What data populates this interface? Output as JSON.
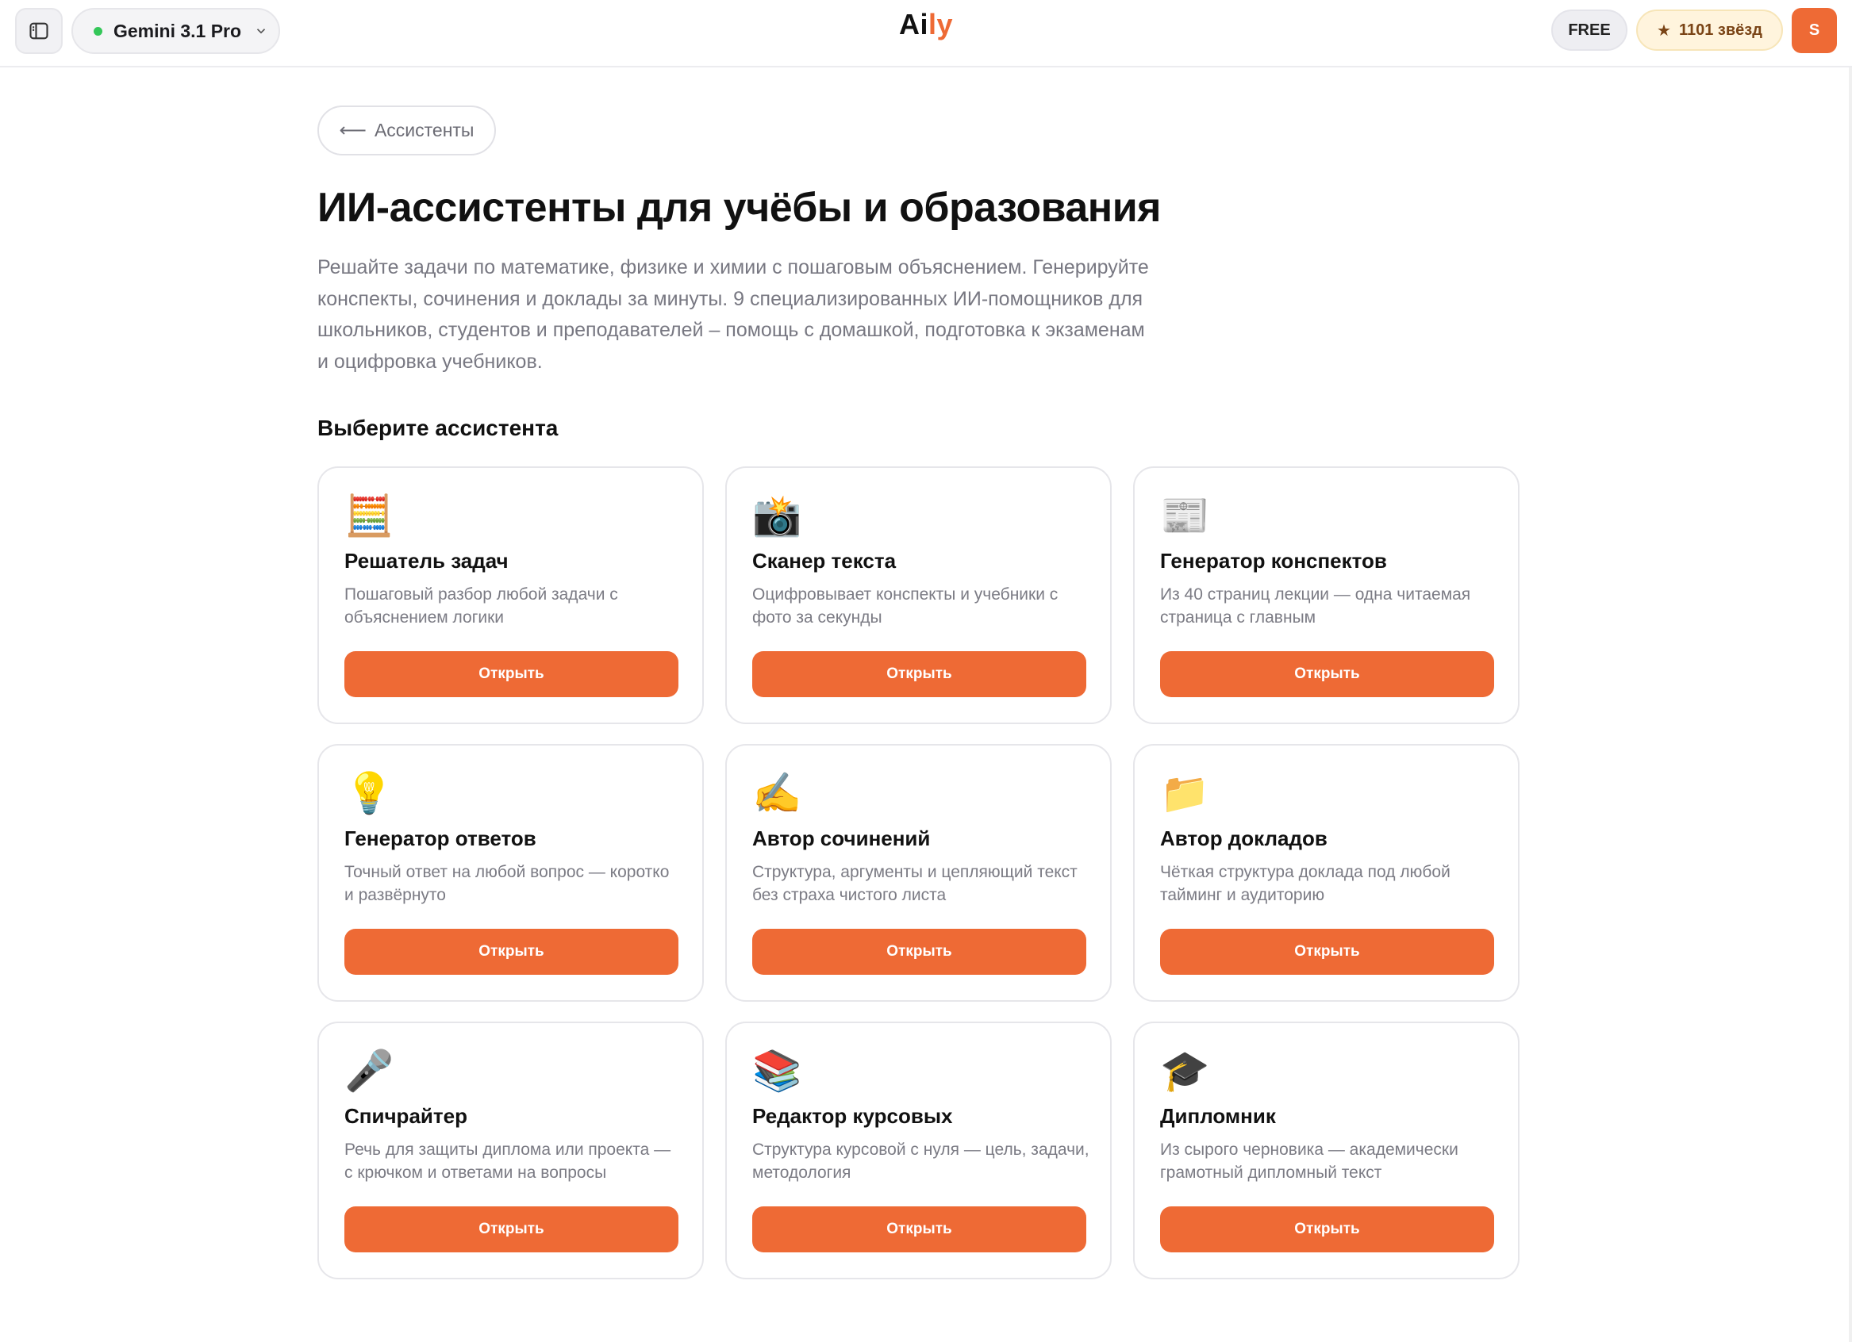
{
  "header": {
    "model": {
      "name": "Gemini 3.1 Pro",
      "status_color": "#34c759"
    },
    "logo": {
      "part1": "Ai",
      "part2": "ly"
    },
    "plan": "FREE",
    "stars": {
      "icon": "star-icon",
      "text": "1101 звёзд"
    },
    "avatar_initial": "S",
    "accent": "#ee6a35"
  },
  "main": {
    "back_label": "Ассистенты",
    "title": "ИИ-ассистенты для учёбы и образования",
    "description": "Решайте задачи по математике, физике и химии с пошаговым объяснением. Генерируйте конспекты, сочинения и доклады за минуты. 9 специализированных ИИ-помощников для школьников, студентов и преподавателей – помощь с домашкой, подготовка к экзаменам и оцифровка учебников.",
    "section_title": "Выберите ассистента",
    "cards": [
      {
        "icon": "abacus-icon",
        "glyph": "🧮",
        "title": "Решатель задач",
        "desc": "Пошаговый разбор любой задачи с объяснением логики",
        "button": "Открыть"
      },
      {
        "icon": "camera-flash-icon",
        "glyph": "📸",
        "title": "Сканер текста",
        "desc": "Оцифровывает конспекты и учебники с фото за секунды",
        "button": "Открыть"
      },
      {
        "icon": "newspaper-icon",
        "glyph": "📰",
        "title": "Генератор конспектов",
        "desc": "Из 40 страниц лекции — одна читаемая страница с главным",
        "button": "Открыть"
      },
      {
        "icon": "light-bulb-icon",
        "glyph": "💡",
        "title": "Генератор ответов",
        "desc": "Точный ответ на любой вопрос — коротко и развёрнуто",
        "button": "Открыть"
      },
      {
        "icon": "writing-hand-icon",
        "glyph": "✍️",
        "title": "Автор сочинений",
        "desc": "Структура, аргументы и цепляющий текст без страха чистого листа",
        "button": "Открыть"
      },
      {
        "icon": "folder-icon",
        "glyph": "📁",
        "title": "Автор докладов",
        "desc": "Чёткая структура доклада под любой тайминг и аудиторию",
        "button": "Открыть"
      },
      {
        "icon": "microphone-icon",
        "glyph": "🎤",
        "title": "Спичрайтер",
        "desc": "Речь для защиты диплома или проекта — с крючком и ответами на вопросы",
        "button": "Открыть"
      },
      {
        "icon": "books-icon",
        "glyph": "📚",
        "title": "Редактор курсовых",
        "desc": "Структура курсовой с нуля — цель, задачи, методология",
        "button": "Открыть"
      },
      {
        "icon": "graduation-cap-icon",
        "glyph": "🎓",
        "title": "Дипломник",
        "desc": "Из сырого черновика — академически грамотный дипломный текст",
        "button": "Открыть"
      }
    ]
  }
}
